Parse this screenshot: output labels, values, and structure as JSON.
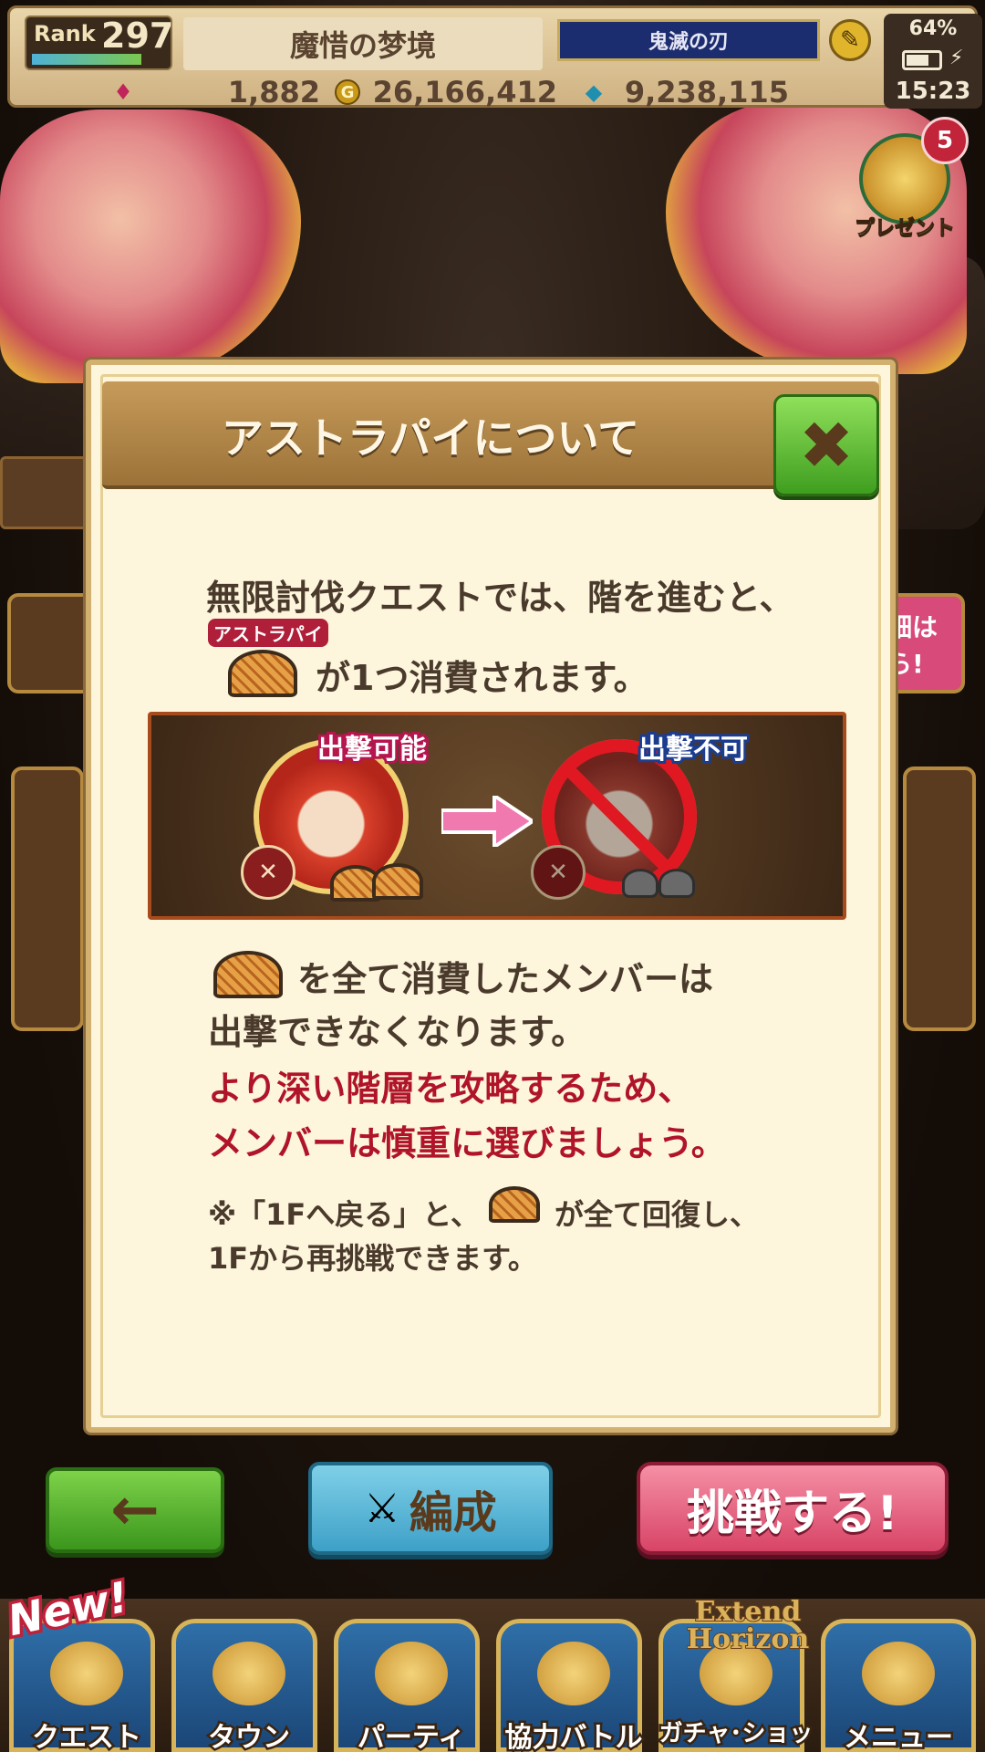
{
  "header": {
    "rank_label": "Rank",
    "rank_value": "297",
    "stage_title": "魔惜の梦境",
    "event_banner": "鬼滅の刃",
    "gems": "1,882",
    "coins": "26,166,412",
    "mana": "9,238,115",
    "battery": "64%",
    "time": "15:23"
  },
  "present": {
    "count": "5",
    "label": "プレゼント"
  },
  "side_right_text": [
    "細は",
    "ら!"
  ],
  "dialog": {
    "title": "アストラパイについて",
    "line1": "無限討伐クエストでは、階を進むと、",
    "pie_tag": "アストラパイ",
    "line2": "が1つ消費されます。",
    "sortie_ok": "出撃可能",
    "sortie_ng": "出撃不可",
    "line3": "を全て消費したメンバーは",
    "line4": "出撃できなくなります。",
    "line5": "より深い階層を攻略するため、",
    "line6": "メンバーは慎重に選びましょう。",
    "note1a": "※「1Fへ戻る」と、",
    "note1b": "が全て回復し、",
    "note2": "1Fから再挑戦できます。"
  },
  "buttons": {
    "back_glyph": "←",
    "team": "編成",
    "challenge": "挑戦する!"
  },
  "nav": {
    "new_badge": "New!",
    "extend_logo_1": "Extend",
    "extend_logo_2": "Horizon",
    "items": [
      {
        "label": "クエスト",
        "icon": "quest-icon"
      },
      {
        "label": "タウン",
        "icon": "town-icon"
      },
      {
        "label": "パーティ",
        "icon": "party-icon"
      },
      {
        "label": "協力バトル",
        "icon": "coop-battle-icon"
      },
      {
        "label": "ガチャ･ショップ",
        "icon": "gacha-shop-icon"
      },
      {
        "label": "メニュー",
        "icon": "menu-icon"
      }
    ]
  },
  "colors": {
    "accent_green": "#3f9e1f",
    "accent_pink": "#d84466",
    "warning_red": "#b0142a"
  }
}
